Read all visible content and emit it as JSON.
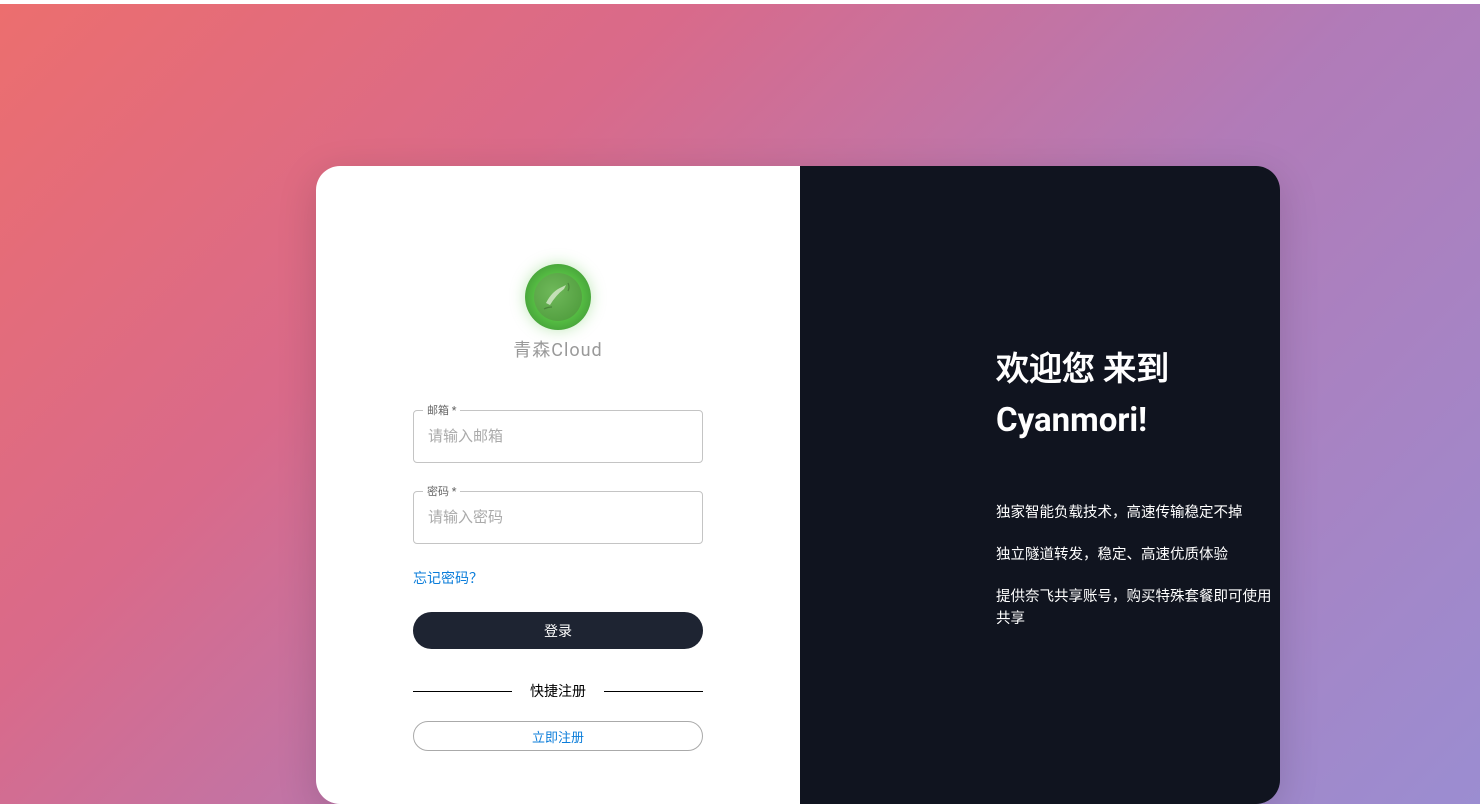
{
  "logo": {
    "text": "青森Cloud"
  },
  "form": {
    "email": {
      "label": "邮箱 *",
      "placeholder": "请输入邮箱"
    },
    "password": {
      "label": "密码 *",
      "placeholder": "请输入密码"
    },
    "forgot": "忘记密码？",
    "login": "登录",
    "divider": "快捷注册",
    "register": "立即注册"
  },
  "welcome": {
    "title": "欢迎您 来到 Cyanmori!",
    "features": [
      "独家智能负载技术，高速传输稳定不掉",
      "独立隧道转发，稳定、高速优质体验",
      "提供奈飞共享账号，购买特殊套餐即可使用共享"
    ]
  }
}
